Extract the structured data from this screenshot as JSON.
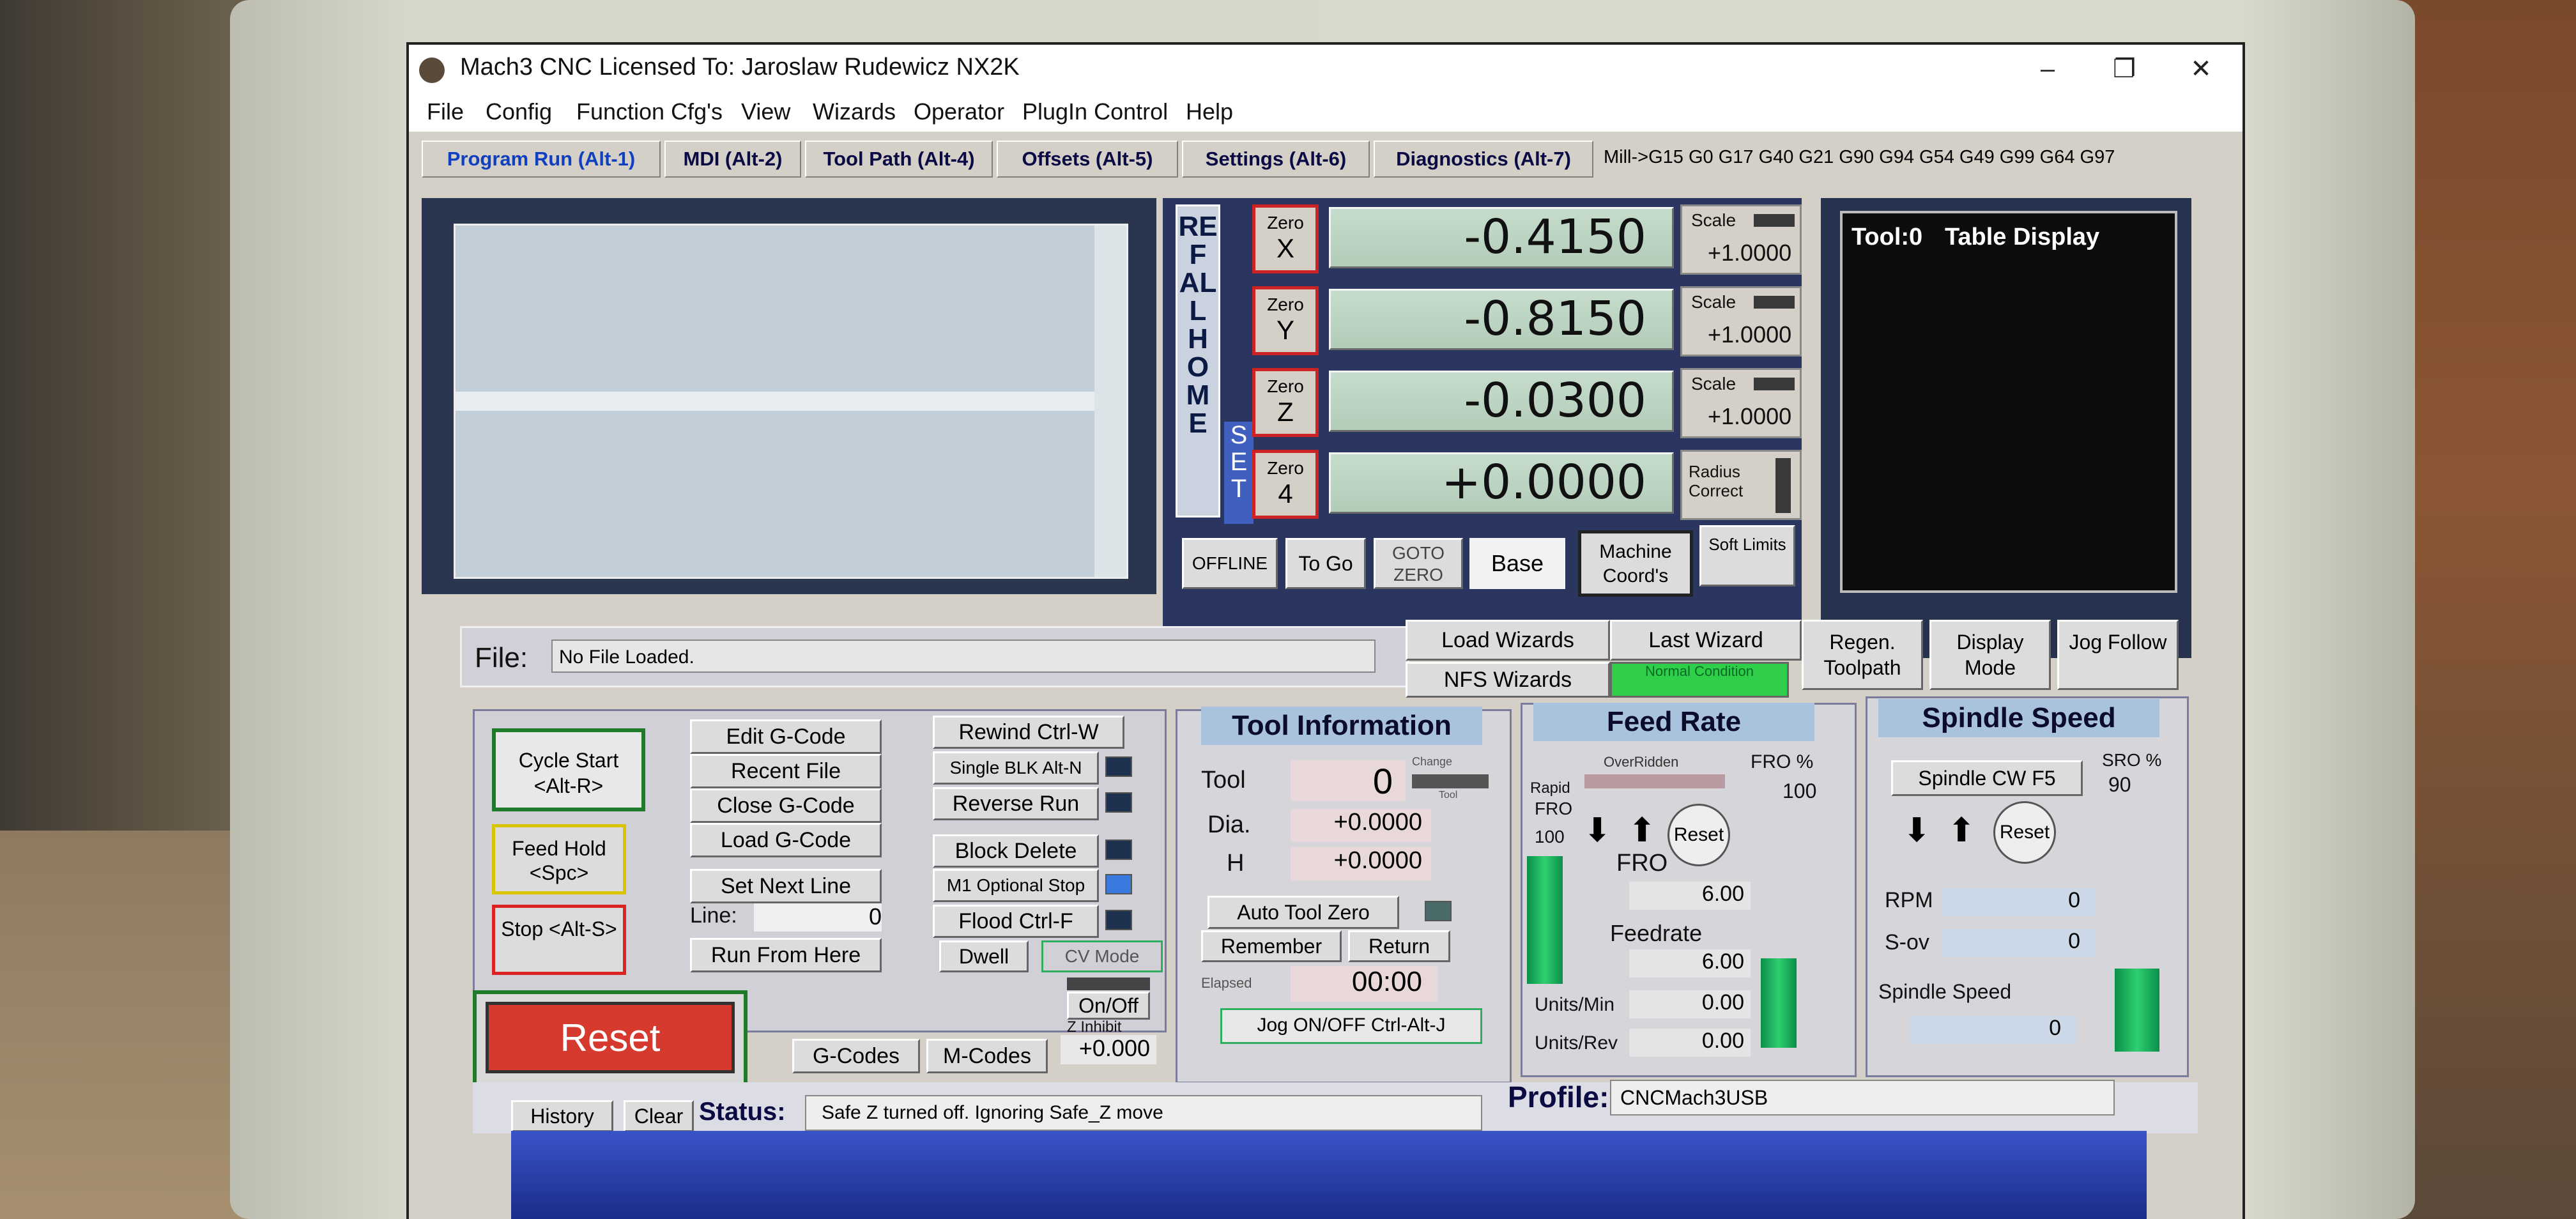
{
  "window": {
    "title": "Mach3 CNC  Licensed To: Jaroslaw Rudewicz NX2K",
    "controls": {
      "minimize": "–",
      "restore": "❐",
      "close": "✕"
    }
  },
  "menu": [
    "File",
    "Config",
    "Function Cfg's",
    "View",
    "Wizards",
    "Operator",
    "PlugIn Control",
    "Help"
  ],
  "tabs": [
    "Program Run (Alt-1)",
    "MDI (Alt-2)",
    "Tool Path (Alt-4)",
    "Offsets (Alt-5)",
    "Settings (Alt-6)",
    "Diagnostics (Alt-7)"
  ],
  "modal_gcodes": "Mill->G15  G0 G17 G40 G21 G90 G94 G54 G49 G99 G64 G97",
  "ref_all_home": "REF ALL HOME",
  "set_label": "SET",
  "axes": [
    {
      "zero_top": "Zero",
      "zero_axis": "X",
      "value": "-0.4150",
      "scale_label": "Scale",
      "scale_value": "+1.0000"
    },
    {
      "zero_top": "Zero",
      "zero_axis": "Y",
      "value": "-0.8150",
      "scale_label": "Scale",
      "scale_value": "+1.0000"
    },
    {
      "zero_top": "Zero",
      "zero_axis": "Z",
      "value": "-0.0300",
      "scale_label": "Scale",
      "scale_value": "+1.0000"
    },
    {
      "zero_top": "Zero",
      "zero_axis": "4",
      "value": "+0.0000",
      "scale_label": "Radius Correct",
      "scale_value": ""
    }
  ],
  "dro_buttons": {
    "offline": "OFFLINE",
    "to_go": "To Go",
    "goto_zero": "GOTO ZERO",
    "base": "Base",
    "machine_coords": "Machine Coord's",
    "soft_limits": "Soft Limits"
  },
  "table_display": {
    "tool": "Tool:0",
    "title": "Table Display"
  },
  "file": {
    "label": "File:",
    "value": "No File Loaded."
  },
  "wizards": {
    "load": "Load Wizards",
    "last": "Last Wizard",
    "nfs": "NFS Wizards",
    "condition": "Normal Condition"
  },
  "toolpath_buttons": {
    "regen": "Regen. Toolpath",
    "display_mode": "Display Mode",
    "jog_follow": "Jog Follow"
  },
  "program": {
    "cycle_start": "Cycle Start <Alt-R>",
    "feed_hold": "Feed Hold <Spc>",
    "stop": "Stop <Alt-S>",
    "edit": "Edit G-Code",
    "recent": "Recent File",
    "close": "Close G-Code",
    "load": "Load G-Code",
    "set_next": "Set Next Line",
    "line_label": "Line:",
    "line_value": "0",
    "run_from": "Run From Here",
    "rewind": "Rewind Ctrl-W",
    "single_blk": "Single BLK Alt-N",
    "reverse": "Reverse Run",
    "block_delete": "Block Delete",
    "m1_optional": "M1 Optional Stop",
    "flood": "Flood Ctrl-F",
    "dwell": "Dwell",
    "cv_mode": "CV Mode",
    "reset": "Reset",
    "onoff": "On/Off",
    "z_inhibit": "Z Inhibit",
    "z_inhibit_value": "+0.000",
    "gcodes": "G-Codes",
    "mcodes": "M-Codes"
  },
  "tool_info": {
    "title": "Tool Information",
    "tool_label": "Tool",
    "tool_value": "0",
    "change_label": "Change",
    "change_sub": "Tool",
    "dia_label": "Dia.",
    "dia_value": "+0.0000",
    "h_label": "H",
    "h_value": "+0.0000",
    "auto_zero": "Auto Tool Zero",
    "remember": "Remember",
    "return": "Return",
    "elapsed_label": "Elapsed",
    "elapsed_value": "00:00",
    "jog": "Jog ON/OFF Ctrl-Alt-J"
  },
  "feed": {
    "title": "Feed Rate",
    "overridden": "OverRidden",
    "fro_pct_label": "FRO %",
    "fro_pct_value": "100",
    "rapid": "Rapid",
    "rapid_fro": "FRO",
    "rapid_value": "100",
    "reset": "Reset",
    "fro_label": "FRO",
    "fro_value": "6.00",
    "feedrate_label": "Feedrate",
    "feedrate_value": "6.00",
    "units_min_label": "Units/Min",
    "units_min_value": "0.00",
    "units_rev_label": "Units/Rev",
    "units_rev_value": "0.00"
  },
  "spindle": {
    "title": "Spindle Speed",
    "cw": "Spindle CW F5",
    "sro_label": "SRO %",
    "sro_value": "90",
    "reset": "Reset",
    "rpm_label": "RPM",
    "rpm_value": "0",
    "sov_label": "S-ov",
    "sov_value": "0",
    "speed_label": "Spindle Speed",
    "speed_value": "0"
  },
  "status": {
    "history": "History",
    "clear": "Clear",
    "label": "Status:",
    "value": "Safe Z turned off. Ignoring Safe_Z move",
    "profile_label": "Profile:",
    "profile_value": "CNCMach3USB"
  },
  "colors": {
    "accent_blue": "#a9c2de",
    "led_green": "#2fcf70",
    "reset_red": "#d63a2f"
  }
}
